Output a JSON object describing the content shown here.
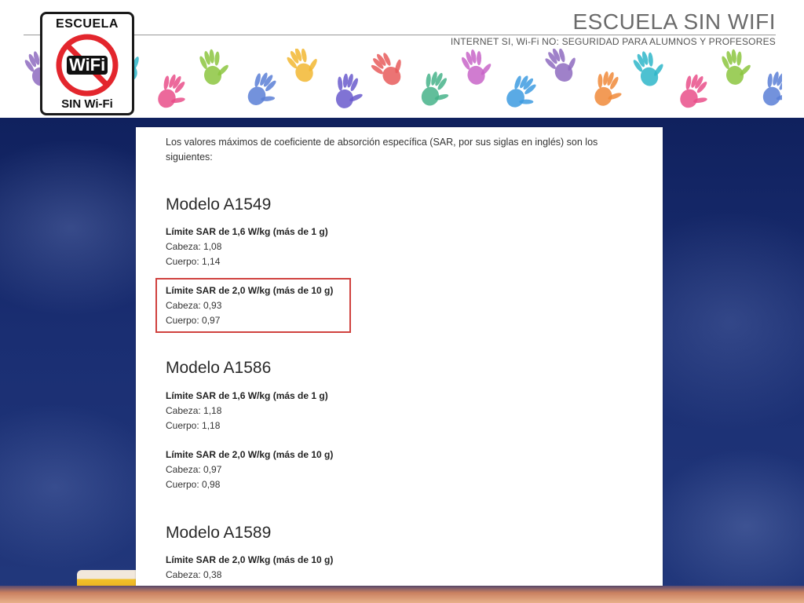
{
  "header": {
    "title": "ESCUELA SIN WIFI",
    "subtitle": "INTERNET SI, Wi-Fi NO: SEGURIDAD PARA ALUMNOS Y PROFESORES",
    "logo": {
      "top_text": "ESCUELA",
      "center_text": "WiFi",
      "bottom_text": "SIN Wi-Fi",
      "icon": "no-wifi-prohibition-sign"
    },
    "decoration": "colorful-handprints"
  },
  "document": {
    "intro": "Los valores máximos de coeficiente de absorción específica (SAR, por sus siglas en inglés) son los siguientes:",
    "models": [
      {
        "name": "Modelo A1549",
        "groups": [
          {
            "label": "Límite SAR de 1,6 W/kg (más de 1 g)",
            "head": "Cabeza: 1,08",
            "body": "Cuerpo: 1,14"
          },
          {
            "label": "Límite SAR de 2,0 W/kg (más de 10 g)",
            "head": "Cabeza: 0,93",
            "body": "Cuerpo: 0,97",
            "highlighted": true
          }
        ]
      },
      {
        "name": "Modelo A1586",
        "groups": [
          {
            "label": "Límite SAR de 1,6 W/kg (más de 1 g)",
            "head": "Cabeza: 1,18",
            "body": "Cuerpo: 1,18"
          },
          {
            "label": "Límite SAR de 2,0 W/kg (más de 10 g)",
            "head": "Cabeza: 0,97",
            "body": "Cuerpo: 0,98"
          }
        ]
      },
      {
        "name": "Modelo A1589",
        "groups": [
          {
            "label": "Límite SAR de 2,0 W/kg (más de 10 g)",
            "head": "Cabeza: 0,38"
          }
        ]
      }
    ]
  },
  "colors": {
    "highlight_border": "#d0423f",
    "board": "#1a2e72",
    "title_gray": "#6b6b6b"
  }
}
